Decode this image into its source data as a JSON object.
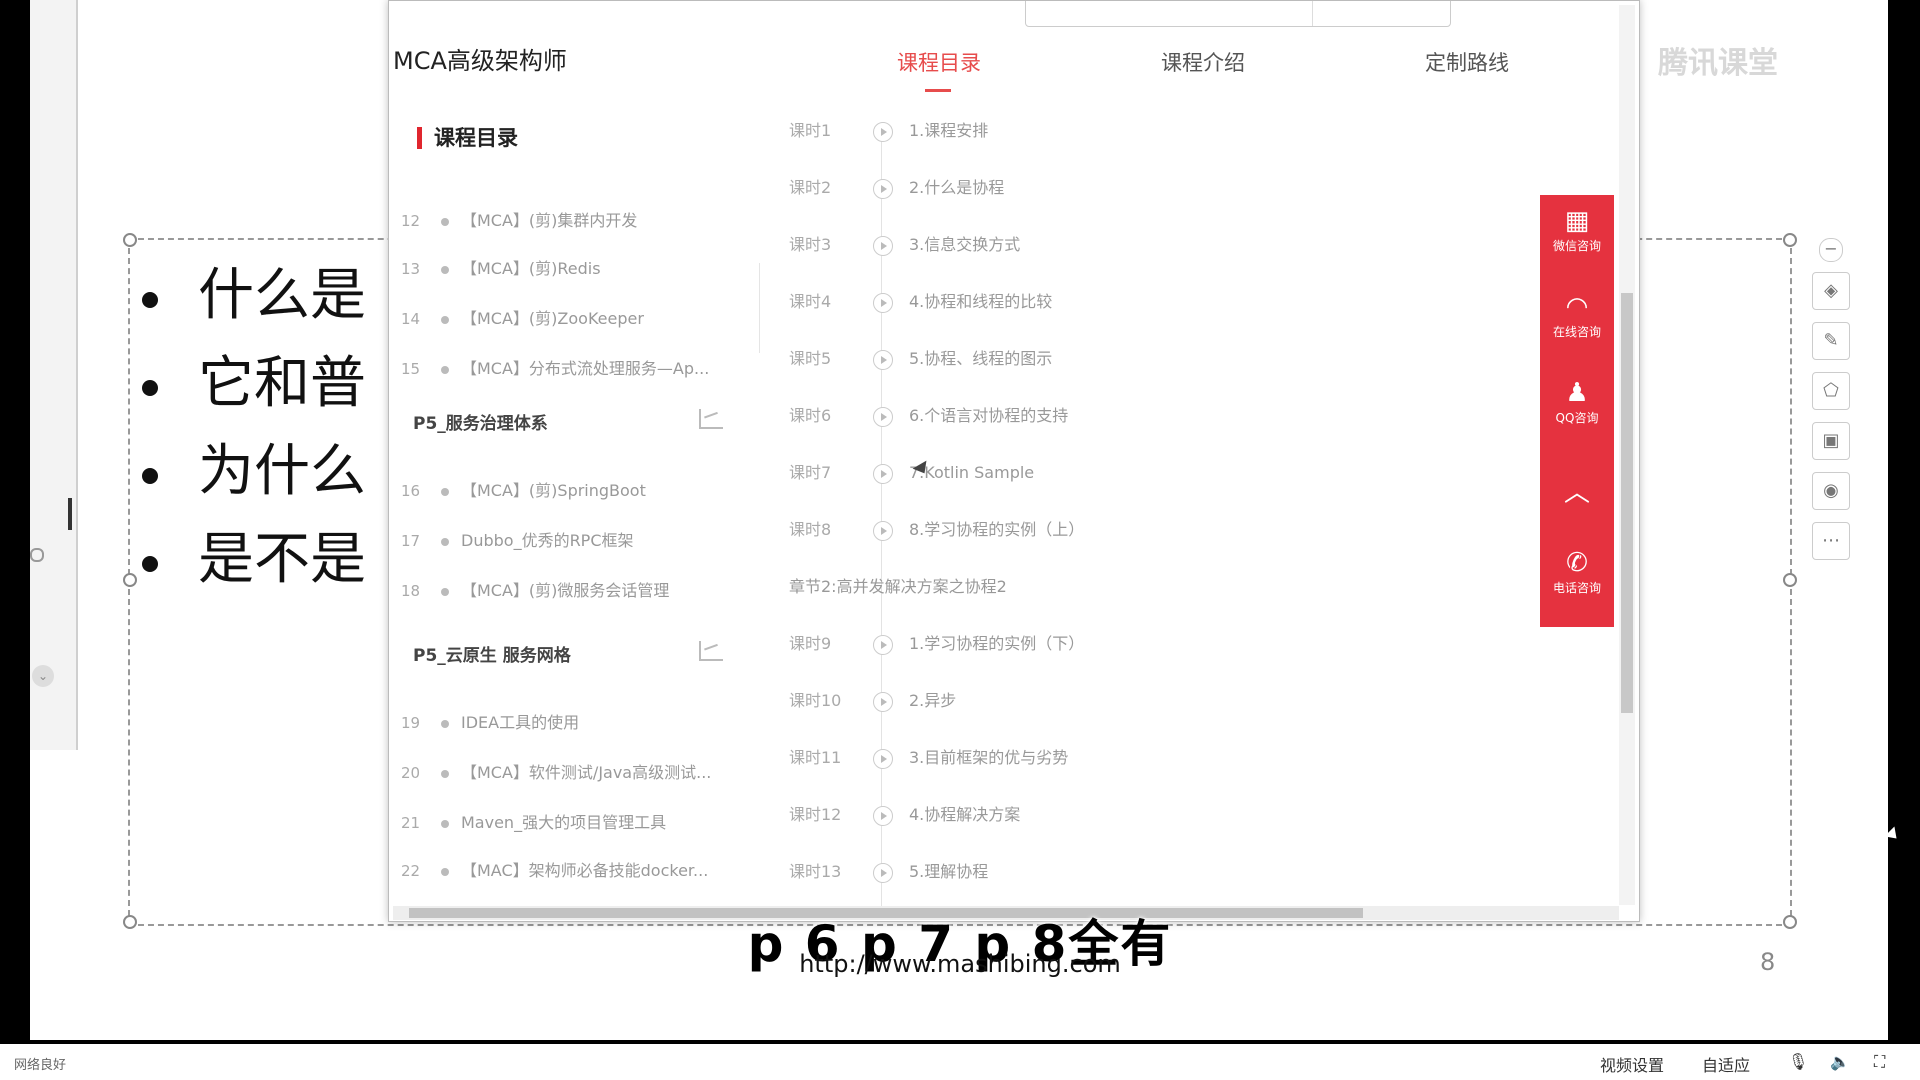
{
  "browser": {
    "brand": "MCA高级架构师",
    "tabs": [
      "课程目录",
      "课程介绍",
      "定制路线"
    ],
    "catalog_title": "课程目录"
  },
  "course_list": [
    {
      "num": "12",
      "title": "【MCA】(剪)集群内开发"
    },
    {
      "num": "13",
      "title": "【MCA】(剪)Redis"
    },
    {
      "num": "14",
      "title": "【MCA】(剪)ZooKeeper"
    },
    {
      "num": "15",
      "title": "【MCA】分布式流处理服务—Ap..."
    },
    {
      "section": "P5_服务治理体系"
    },
    {
      "num": "16",
      "title": "【MCA】(剪)SpringBoot"
    },
    {
      "num": "17",
      "title": "Dubbo_优秀的RPC框架"
    },
    {
      "num": "18",
      "title": "【MCA】(剪)微服务会话管理"
    },
    {
      "section": "P5_云原生 服务网格"
    },
    {
      "num": "19",
      "title": "IDEA工具的使用"
    },
    {
      "num": "20",
      "title": "【MCA】软件测试/Java高级测试..."
    },
    {
      "num": "21",
      "title": "Maven_强大的项目管理工具"
    },
    {
      "num": "22",
      "title": "【MAC】架构师必备技能docker..."
    }
  ],
  "lessons": [
    {
      "key": "课时1",
      "title": "1.课程安排"
    },
    {
      "key": "课时2",
      "title": "2.什么是协程"
    },
    {
      "key": "课时3",
      "title": "3.信息交换方式"
    },
    {
      "key": "课时4",
      "title": "4.协程和线程的比较"
    },
    {
      "key": "课时5",
      "title": "5.协程、线程的图示"
    },
    {
      "key": "课时6",
      "title": "6.个语言对协程的支持"
    },
    {
      "key": "课时7",
      "title": "7.Kotlin Sample"
    },
    {
      "key": "课时8",
      "title": "8.学习协程的实例（上）"
    },
    {
      "chapter": "章节2:高并发解决方案之协程2"
    },
    {
      "key": "课时9",
      "title": "1.学习协程的实例（下）"
    },
    {
      "key": "课时10",
      "title": "2.异步"
    },
    {
      "key": "课时11",
      "title": "3.目前框架的优与劣势"
    },
    {
      "key": "课时12",
      "title": "4.协程解决方案"
    },
    {
      "key": "课时13",
      "title": "5.理解协程"
    }
  ],
  "red_panel": [
    {
      "icon": "qr-code-icon",
      "glyph": "▦",
      "label": "微信咨询"
    },
    {
      "icon": "headset-icon",
      "glyph": "◠",
      "label": "在线咨询"
    },
    {
      "icon": "qq-icon",
      "glyph": "♟",
      "label": "QQ咨询"
    },
    {
      "icon": "back-to-top-icon",
      "glyph": "︿",
      "label": ""
    },
    {
      "icon": "phone-icon",
      "glyph": "✆",
      "label": "电话咨询"
    }
  ],
  "slide": {
    "bullets": [
      "什么是",
      "它和普",
      "为什么",
      "是不是"
    ],
    "page_number": "8"
  },
  "watermark": "腾讯课堂",
  "subtitle": "p 6 p 7 p 8全有",
  "url_overlay": "http://www.mashibing.com",
  "bottom_bar": {
    "network": "网络良好",
    "video_settings": "视频设置",
    "adaptive": "自适应"
  }
}
